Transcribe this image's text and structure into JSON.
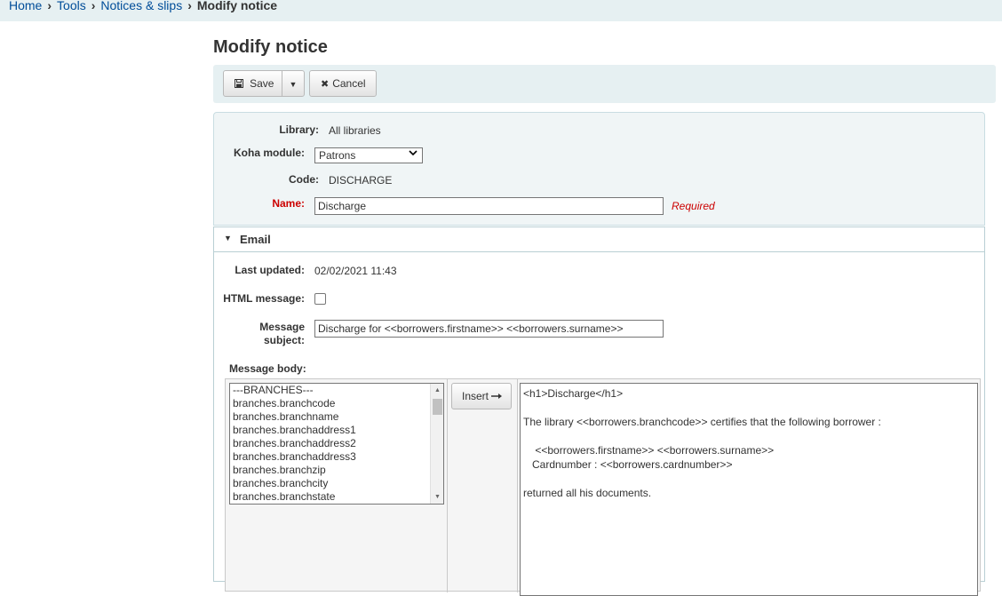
{
  "breadcrumb": {
    "items": [
      "Home",
      "Tools",
      "Notices & slips"
    ],
    "current": "Modify notice",
    "separator": "›"
  },
  "page": {
    "title": "Modify notice"
  },
  "toolbar": {
    "save_label": "Save",
    "cancel_label": "Cancel"
  },
  "form": {
    "library_label": "Library:",
    "library_value": "All libraries",
    "module_label": "Koha module:",
    "module_value": "Patrons",
    "code_label": "Code:",
    "code_value": "DISCHARGE",
    "name_label": "Name:",
    "name_value": "Discharge",
    "required_note": "Required"
  },
  "email": {
    "section_title": "Email",
    "last_updated_label": "Last updated:",
    "last_updated_value": "02/02/2021 11:43",
    "html_message_label": "HTML message:",
    "subject_label_line1": "Message",
    "subject_label_line2": "subject:",
    "subject_value": "Discharge for <<borrowers.firstname>> <<borrowers.surname>>",
    "body_label": "Message body:",
    "insert_label": "Insert",
    "fields": [
      "---BRANCHES---",
      "branches.branchcode",
      "branches.branchname",
      "branches.branchaddress1",
      "branches.branchaddress2",
      "branches.branchaddress3",
      "branches.branchzip",
      "branches.branchcity",
      "branches.branchstate"
    ],
    "body_value": "<h1>Discharge</h1>\n\nThe library <<borrowers.branchcode>> certifies that the following borrower :\n\n    <<borrowers.firstname>> <<borrowers.surname>>\n   Cardnumber : <<borrowers.cardnumber>>\n\nreturned all his documents."
  }
}
